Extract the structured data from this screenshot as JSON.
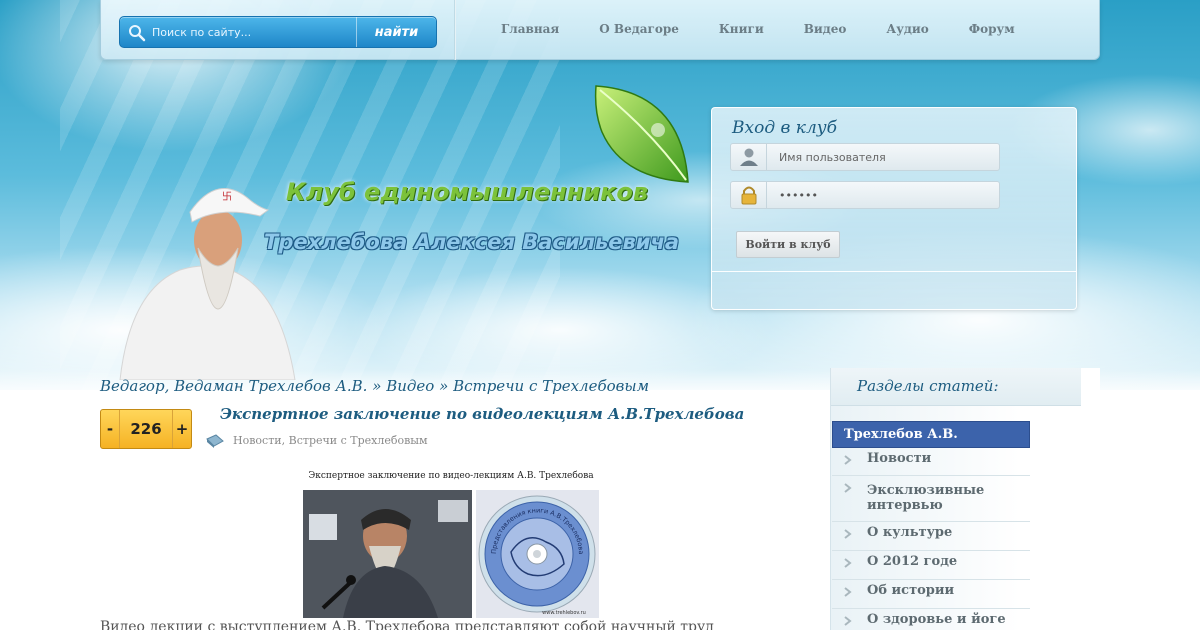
{
  "search": {
    "placeholder": "Поиск по сайту...",
    "button_label": "найти"
  },
  "nav": {
    "items": [
      {
        "label": "Главная"
      },
      {
        "label": "О Ведагоре"
      },
      {
        "label": "Книги"
      },
      {
        "label": "Видео"
      },
      {
        "label": "Аудио"
      },
      {
        "label": "Форум"
      }
    ]
  },
  "header": {
    "title_line1": "Клуб единомышленников",
    "title_line2": "Трехлебова Алексея Васильевича"
  },
  "login": {
    "title": "Вход в клуб",
    "username_placeholder": "Имя пользователя",
    "password_value": "••••••",
    "button_label": "Войти в клуб"
  },
  "breadcrumb": {
    "items": [
      {
        "label": "Ведагор, Ведаман Трехлебов А.В."
      },
      {
        "label": "Видео"
      },
      {
        "label": "Встречи с Трехлебовым"
      }
    ],
    "separator": "»"
  },
  "article": {
    "rating": {
      "minus": "-",
      "value": "226",
      "plus": "+"
    },
    "title": "Экспертное заключение по видеолекциям А.В.Трехлебова",
    "categories": [
      {
        "label": "Новости"
      },
      {
        "label": "Встречи с Трехлебовым"
      }
    ],
    "category_separator": ", ",
    "image_caption": "Экспертное заключение по видео-лекциям А.В. Трехлебова",
    "disc_text": "Представления книги А.В.Трехлебова «Кощуны Финиста»",
    "disc_site": "www.trehlebov.ru",
    "text": "Видео лекции с выступлением А.В. Трехлебова представляют собой научный труд"
  },
  "sidebar": {
    "title": "Разделы статей:",
    "active": "Трехлебов А.В.",
    "items": [
      {
        "label": "Новости"
      },
      {
        "label": "Эксклюзивные интервью"
      },
      {
        "label": "О культуре"
      },
      {
        "label": "О 2012 годе"
      },
      {
        "label": "Об истории"
      },
      {
        "label": "О здоровье и йоге"
      }
    ]
  },
  "colors": {
    "accent_blue": "#1d5c80",
    "sidebar_active": "#3c63ab",
    "rating_gold": "#f5b224",
    "title_green": "#7cc23a"
  }
}
